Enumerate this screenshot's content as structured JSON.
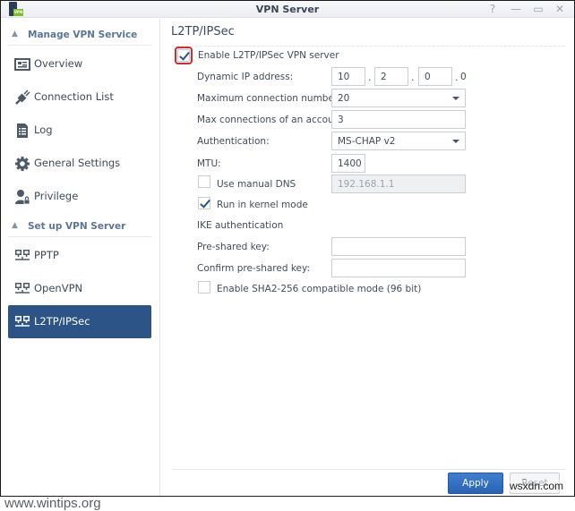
{
  "window": {
    "title": "VPN Server",
    "controls": {
      "help": "?",
      "minimize": "—",
      "maximize": "▭",
      "close": "✕"
    },
    "app_icon_tag": "VPN"
  },
  "sidebar": {
    "sections": [
      {
        "label": "Manage VPN Service",
        "items": [
          {
            "label": "Overview",
            "icon": "overview-icon"
          },
          {
            "label": "Connection List",
            "icon": "plug-icon"
          },
          {
            "label": "Log",
            "icon": "log-icon"
          },
          {
            "label": "General Settings",
            "icon": "gear-icon"
          },
          {
            "label": "Privilege",
            "icon": "user-lock-icon"
          }
        ]
      },
      {
        "label": "Set up VPN Server",
        "items": [
          {
            "label": "PPTP",
            "icon": "network-icon"
          },
          {
            "label": "OpenVPN",
            "icon": "network-icon"
          },
          {
            "label": "L2TP/IPSec",
            "icon": "network-icon",
            "active": true
          }
        ]
      }
    ]
  },
  "main": {
    "title": "L2TP/IPSec",
    "enable_label": "Enable L2TP/IPSec VPN server",
    "enable_checked": true,
    "dynamic_ip_label": "Dynamic IP address:",
    "dynamic_ip": [
      "10",
      "2",
      "0",
      "0"
    ],
    "max_conn_label": "Maximum connection number:",
    "max_conn_value": "20",
    "max_acct_label": "Max connections of an account:",
    "max_acct_value": "3",
    "auth_label": "Authentication:",
    "auth_value": "MS-CHAP v2",
    "mtu_label": "MTU:",
    "mtu_value": "1400",
    "manual_dns_label": "Use manual DNS",
    "manual_dns_checked": false,
    "manual_dns_value": "192.168.1.1",
    "kernel_mode_label": "Run in kernel mode",
    "kernel_mode_checked": true,
    "ike_label": "IKE authentication",
    "psk_label": "Pre-shared key:",
    "psk_value": "",
    "confirm_psk_label": "Confirm pre-shared key:",
    "confirm_psk_value": "",
    "sha2_label": "Enable SHA2-256 compatible mode (96 bit)",
    "sha2_checked": false,
    "dot": "."
  },
  "footer": {
    "apply": "Apply",
    "reset": "Reset"
  },
  "watermarks": {
    "left": "www.wintips.org",
    "right": "wsxdn.com"
  },
  "colors": {
    "accent": "#2d5487",
    "apply_button": "#3572c4",
    "highlight": "#d42b2b"
  }
}
